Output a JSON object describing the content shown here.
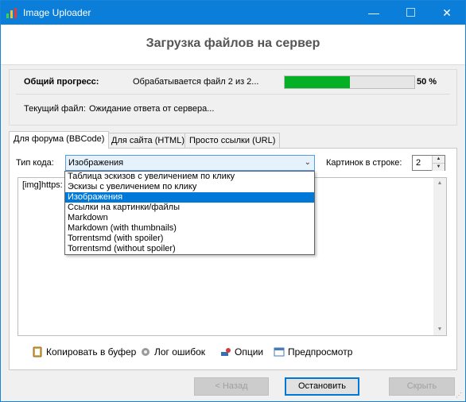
{
  "window": {
    "title": "Image Uploader",
    "minimize": "—",
    "close": "✕"
  },
  "header": {
    "title": "Загрузка файлов на сервер"
  },
  "progress": {
    "label": "Общий прогресс:",
    "status": "Обрабатывается файл 2 из 2...",
    "percent_text": "50 %",
    "percent": 50,
    "current_file_label": "Текущий файл:",
    "current_file_value": "Ожидание ответа от сервера..."
  },
  "tabs": [
    {
      "label": "Для форума (BBCode)",
      "active": true
    },
    {
      "label": "Для сайта (HTML)",
      "active": false
    },
    {
      "label": "Просто ссылки (URL)",
      "active": false
    }
  ],
  "code_type": {
    "label": "Тип кода:",
    "selected": "Изображения",
    "options": [
      "Таблица эскизов с увеличением по клику",
      "Эскизы с увеличением по клику",
      "Изображения",
      "Ссылки на картинки/файлы",
      "Markdown",
      "Markdown (with thumbnails)",
      "Torrentsmd (with spoiler)",
      "Torrentsmd (without spoiler)"
    ],
    "selected_index": 2
  },
  "per_row": {
    "label": "Картинок в строке:",
    "value": "2"
  },
  "output_text": "[img]https:",
  "actions": {
    "copy": "Копировать в буфер",
    "log": "Лог ошибок",
    "options": "Опции",
    "preview": "Предпросмотр"
  },
  "buttons": {
    "back": "< Назад",
    "stop": "Остановить",
    "hide": "Скрыть"
  },
  "colors": {
    "titlebar": "#0a7ed9",
    "progress": "#06b025",
    "selection": "#0078d7"
  }
}
